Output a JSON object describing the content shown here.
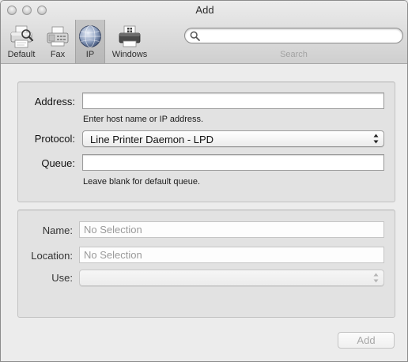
{
  "window": {
    "title": "Add"
  },
  "toolbar": {
    "items": [
      {
        "label": "Default",
        "icon": "printer-icon"
      },
      {
        "label": "Fax",
        "icon": "fax-icon"
      },
      {
        "label": "IP",
        "icon": "globe-icon",
        "selected": true
      },
      {
        "label": "Windows",
        "icon": "windows-printer-icon"
      }
    ],
    "search": {
      "value": "",
      "label": "Search"
    }
  },
  "connection": {
    "address_label": "Address:",
    "address_value": "",
    "address_hint": "Enter host name or IP address.",
    "protocol_label": "Protocol:",
    "protocol_value": "Line Printer Daemon - LPD",
    "queue_label": "Queue:",
    "queue_value": "",
    "queue_hint": "Leave blank for default queue."
  },
  "details": {
    "name_label": "Name:",
    "name_value": "No Selection",
    "location_label": "Location:",
    "location_value": "No Selection",
    "use_label": "Use:",
    "use_value": ""
  },
  "footer": {
    "add_label": "Add"
  },
  "colors": {
    "window_bg": "#ececec",
    "box_bg": "#e2e2e2",
    "disabled_text": "#a8a8a8"
  }
}
